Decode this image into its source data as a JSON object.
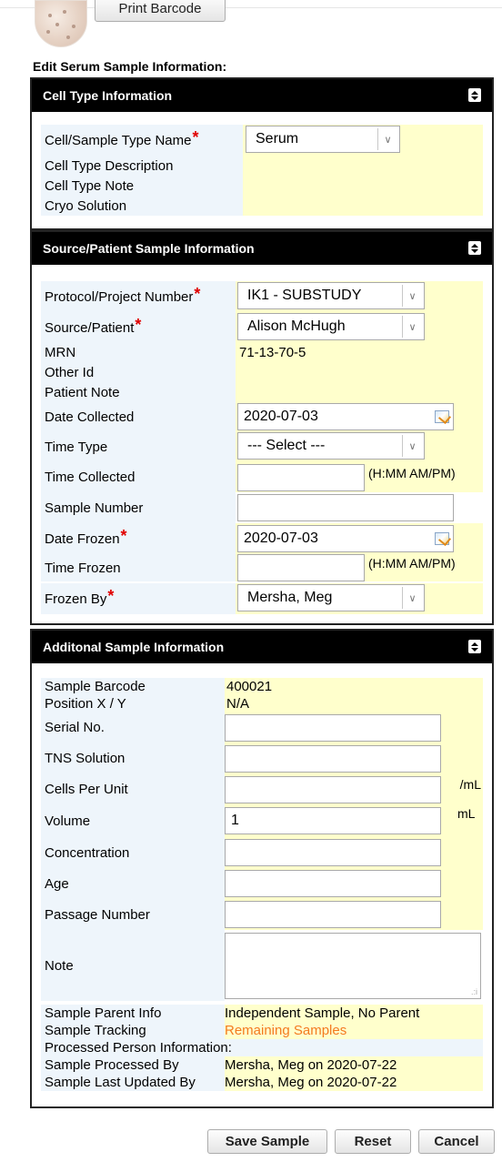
{
  "top": {
    "print_barcode_label": "Print Barcode",
    "edit_title": "Edit Serum Sample Information:"
  },
  "cell_type": {
    "header": "Cell Type Information",
    "name_label": "Cell/Sample Type Name",
    "name_value": "Serum",
    "description_label": "Cell Type Description",
    "note_label": "Cell Type Note",
    "cryo_label": "Cryo Solution"
  },
  "source": {
    "header": "Source/Patient Sample Information",
    "protocol_label": "Protocol/Project Number",
    "protocol_value": "IK1 - SUBSTUDY",
    "patient_label": "Source/Patient",
    "patient_value": "Alison McHugh",
    "mrn_label": "MRN",
    "mrn_value": "71-13-70-5",
    "other_id_label": "Other Id",
    "patient_note_label": "Patient Note",
    "date_collected_label": "Date Collected",
    "date_collected_value": "2020-07-03",
    "time_type_label": "Time Type",
    "time_type_value": "--- Select ---",
    "time_collected_label": "Time Collected",
    "time_hint": "(H:MM AM/PM)",
    "sample_number_label": "Sample Number",
    "date_frozen_label": "Date Frozen",
    "date_frozen_value": "2020-07-03",
    "time_frozen_label": "Time Frozen",
    "frozen_by_label": "Frozen By",
    "frozen_by_value": "Mersha, Meg"
  },
  "additional": {
    "header": "Additonal Sample Information",
    "barcode_label": "Sample Barcode",
    "barcode_value": "400021",
    "position_label": "Position X / Y",
    "position_value": "N/A",
    "serial_label": "Serial No.",
    "tns_label": "TNS Solution",
    "cells_label": "Cells Per Unit",
    "cells_unit": "/mL",
    "volume_label": "Volume",
    "volume_value": "1",
    "volume_unit": "mL",
    "concentration_label": "Concentration",
    "age_label": "Age",
    "passage_label": "Passage Number",
    "note_label": "Note",
    "parent_label": "Sample Parent Info",
    "parent_value": "Independent Sample, No Parent",
    "tracking_label": "Sample Tracking",
    "tracking_value": "Remaining Samples",
    "processed_info_label": "Processed Person Information:",
    "processed_by_label": "Sample Processed By",
    "processed_by_value": "Mersha, Meg on 2020-07-22",
    "updated_by_label": "Sample Last Updated By",
    "updated_by_value": "Mersha, Meg on 2020-07-22"
  },
  "actions": {
    "save": "Save Sample",
    "reset": "Reset",
    "cancel": "Cancel"
  },
  "colors": {
    "label_bg": "#eef5fb",
    "value_bg": "#ffffcc",
    "required": "#e00000",
    "tracking": "#f47a20"
  }
}
